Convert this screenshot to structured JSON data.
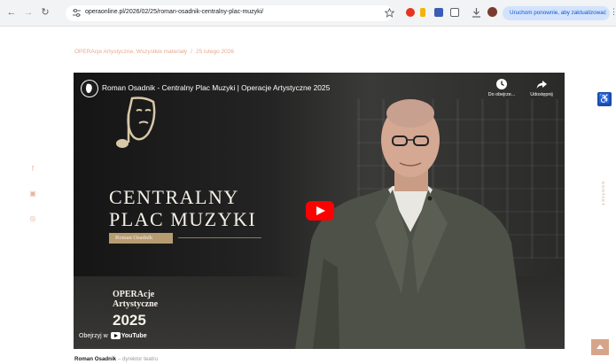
{
  "browser": {
    "url": "operaonline.pl/2026/02/25/roman-osadnik-centralny-plac-muzyki/",
    "update_button": "Uruchom ponownie, aby zaktualizować"
  },
  "breadcrumb": {
    "categories": "OPERAcje Artystyczne, Wszystkie materiały",
    "separator": "/",
    "date": "25 lutego 2026"
  },
  "video": {
    "title": "Roman Osadnik - Centralny Plac Muzyki | Operacje Artystyczne 2025",
    "watch_later_label": "Do obejrze...",
    "share_label": "Udostępnij",
    "headline_line1": "CENTRALNY",
    "headline_line2": "PLAC MUZYKI",
    "speaker_tag": "Roman Osadnik",
    "event_line1": "OPERAcje",
    "event_line2": "Artystyczne",
    "event_year": "2025",
    "watch_on": "Obejrzyj w",
    "youtube": "YouTube"
  },
  "caption": {
    "name": "Roman Osadnik",
    "separator": " – ",
    "role": "dyrektor teatru"
  },
  "side_tab": "KONTAKT",
  "colors": {
    "accent": "#e7a98d",
    "youtube_red": "#ff0000",
    "a11y_blue": "#1e4aa8"
  }
}
